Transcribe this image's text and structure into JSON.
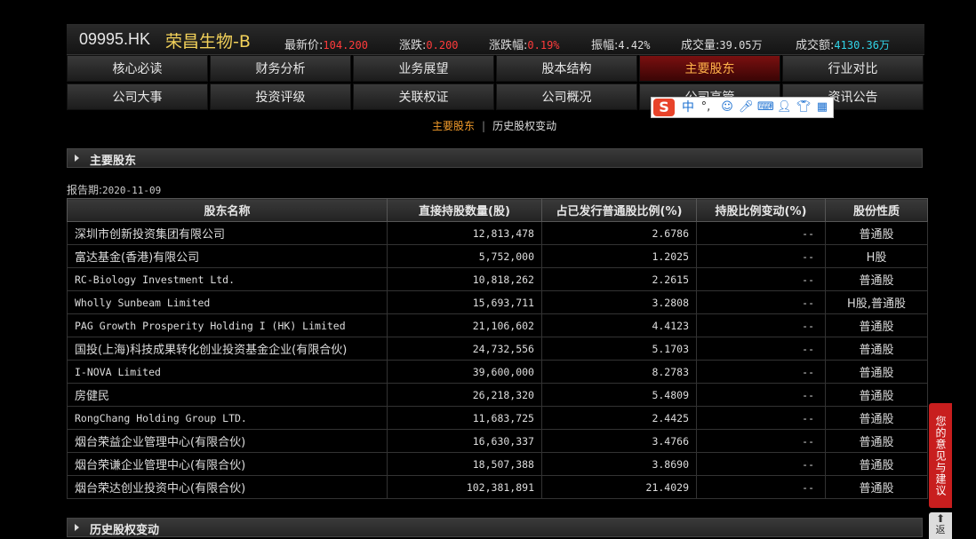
{
  "header": {
    "code": "09995.HK",
    "name": "荣昌生物-B",
    "quotes": [
      {
        "label": "最新价:",
        "value": "104.200",
        "tone": "red"
      },
      {
        "label": "涨跌:",
        "value": "0.200",
        "tone": "red"
      },
      {
        "label": "涨跌幅:",
        "value": "0.19%",
        "tone": "red"
      },
      {
        "label": "振幅:",
        "value": "4.42%",
        "tone": "white"
      },
      {
        "label": "成交量:",
        "value": "39.05万",
        "tone": "white"
      },
      {
        "label": "成交额:",
        "value": "4130.36万",
        "tone": "cyan"
      }
    ]
  },
  "nav": {
    "row1": [
      "核心必读",
      "财务分析",
      "业务展望",
      "股本结构",
      "主要股东",
      "行业对比"
    ],
    "row2": [
      "公司大事",
      "投资评级",
      "关联权证",
      "公司概况",
      "公司高管",
      "资讯公告"
    ],
    "active": "主要股东"
  },
  "subtabs": {
    "main": "主要股东",
    "sep": "|",
    "history": "历史股权变动"
  },
  "section_main": {
    "title": "主要股东"
  },
  "report": {
    "label": "报告期:",
    "date": "2020-11-09"
  },
  "table": {
    "headers": [
      "股东名称",
      "直接持股数量(股)",
      "占已发行普通股比例(%)",
      "持股比例变动(%)",
      "股份性质"
    ],
    "rows": [
      [
        "深圳市创新投资集团有限公司",
        "12,813,478",
        "2.6786",
        "--",
        "普通股"
      ],
      [
        "富达基金(香港)有限公司",
        "5,752,000",
        "1.2025",
        "--",
        "H股"
      ],
      [
        "RC-Biology Investment Ltd.",
        "10,818,262",
        "2.2615",
        "--",
        "普通股"
      ],
      [
        "Wholly Sunbeam Limited",
        "15,693,711",
        "3.2808",
        "--",
        "H股,普通股"
      ],
      [
        "PAG Growth Prosperity Holding I (HK) Limited",
        "21,106,602",
        "4.4123",
        "--",
        "普通股"
      ],
      [
        "国投(上海)科技成果转化创业投资基金企业(有限合伙)",
        "24,732,556",
        "5.1703",
        "--",
        "普通股"
      ],
      [
        "I-NOVA Limited",
        "39,600,000",
        "8.2783",
        "--",
        "普通股"
      ],
      [
        "房健民",
        "26,218,320",
        "5.4809",
        "--",
        "普通股"
      ],
      [
        "RongChang Holding Group LTD.",
        "11,683,725",
        "2.4425",
        "--",
        "普通股"
      ],
      [
        "烟台荣益企业管理中心(有限合伙)",
        "16,630,337",
        "3.4766",
        "--",
        "普通股"
      ],
      [
        "烟台荣谦企业管理中心(有限合伙)",
        "18,507,388",
        "3.8690",
        "--",
        "普通股"
      ],
      [
        "烟台荣达创业投资中心(有限合伙)",
        "102,381,891",
        "21.4029",
        "--",
        "普通股"
      ]
    ]
  },
  "section_history": {
    "title": "历史股权变动"
  },
  "ime": {
    "logo": "S",
    "lang": "中",
    "punct": "°,"
  },
  "feedback": {
    "label": "您的意见与建议"
  },
  "totop": {
    "label": "返"
  }
}
